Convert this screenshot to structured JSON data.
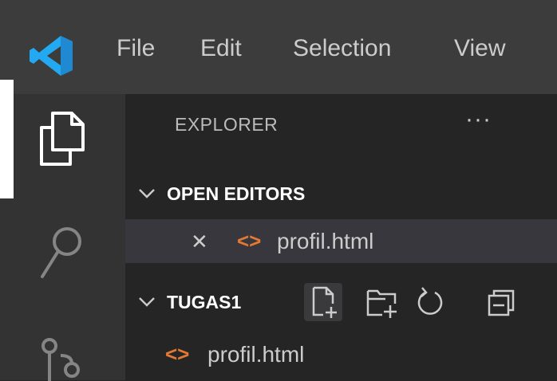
{
  "colors": {
    "titlebar_bg": "#3c3c3c",
    "activitybar_bg": "#333333",
    "sidebar_bg": "#252526",
    "vscode_blue": "#23a9f2",
    "html_icon": "#e37933"
  },
  "menu": [
    "File",
    "Edit",
    "Selection",
    "View"
  ],
  "explorer": {
    "title": "EXPLORER",
    "more": "···"
  },
  "open_editors": {
    "header": "OPEN EDITORS",
    "files": [
      {
        "close_glyph": "✕",
        "icon_glyph": "<>",
        "name": "profil.html"
      }
    ]
  },
  "workspace": {
    "name": "TUGAS1",
    "actions": [
      "new-file-icon",
      "new-folder-icon",
      "refresh-icon",
      "collapse-all-icon"
    ],
    "files": [
      {
        "icon_glyph": "<>",
        "name": "profil.html"
      }
    ]
  }
}
